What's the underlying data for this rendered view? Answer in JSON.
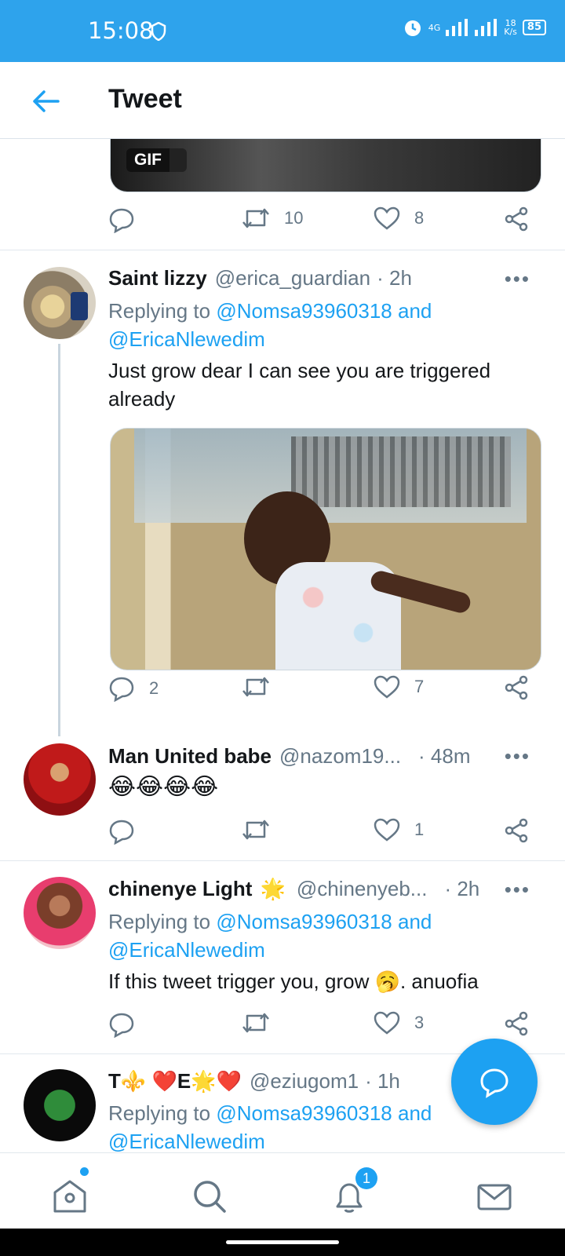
{
  "status": {
    "time": "15:08",
    "network": "4G",
    "speed_value": "18",
    "speed_unit": "K/s",
    "battery": "85"
  },
  "header": {
    "title": "Tweet"
  },
  "top_tweet": {
    "gif_label": "GIF",
    "retweets": "10",
    "likes": "8",
    "replies": ""
  },
  "tweets": [
    {
      "name": "Saint lizzy",
      "handle": "@erica_guardian",
      "time": "· 2h",
      "replying_prefix": "Replying to",
      "mention1": "@Nomsa93960318",
      "and": "and",
      "mention2": "@EricaNlewedim",
      "text": "Just grow dear I can see you are triggered already",
      "replies": "2",
      "retweets": "",
      "likes": "7"
    },
    {
      "name": "Man United babe",
      "handle": "@nazom19...",
      "time": "· 48m",
      "text": "😂😂😂😂",
      "replies": "",
      "retweets": "",
      "likes": "1"
    },
    {
      "name": "chinenye Light",
      "name_emoji": "🌟",
      "handle": "@chinenyeb...",
      "time": "· 2h",
      "replying_prefix": "Replying to",
      "mention1": "@Nomsa93960318",
      "and": "and",
      "mention2": "@EricaNlewedim",
      "text": "If this tweet trigger you, grow 🥱. anuofia",
      "replies": "",
      "retweets": "",
      "likes": "3"
    },
    {
      "name": "T⚜️ ❤️E🌟❤️",
      "handle": "@eziugom1",
      "time": "· 1h",
      "replying_prefix": "Replying to",
      "mention1": "@Nomsa93960318",
      "and": "and",
      "mention2": "@EricaNlewedim"
    }
  ],
  "more_label": "•••",
  "notifications_badge": "1",
  "colors": {
    "accent": "#1da1f2",
    "statusbar": "#2ea3ec",
    "muted": "#657786"
  }
}
